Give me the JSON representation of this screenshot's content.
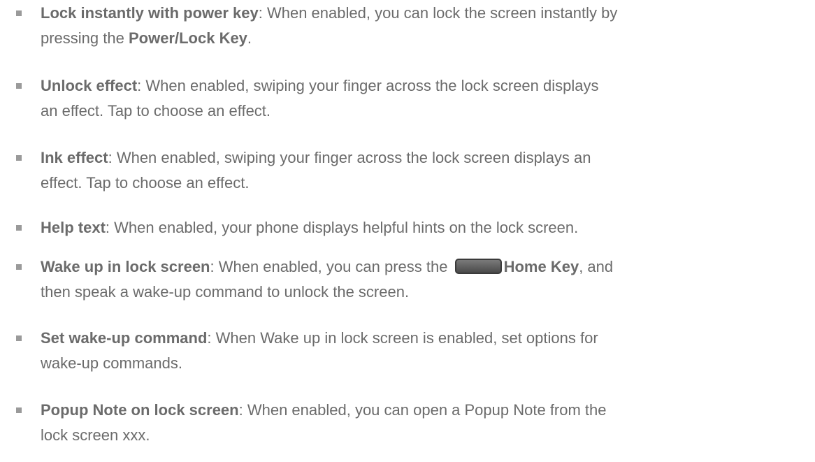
{
  "items": [
    {
      "term": "Lock instantly with power key",
      "line1": ": When enabled, you can lock the screen instantly by",
      "line2_pre": "pressing the ",
      "line2_bold": "Power/Lock Key",
      "line2_post": "."
    },
    {
      "term": "Unlock effect",
      "line1": ": When enabled, swiping your finger across the lock screen displays",
      "line2": "an effect. Tap to choose an effect."
    },
    {
      "term": "Ink effect",
      "line1": ": When enabled, swiping your finger across the lock screen displays an",
      "line2": "effect. Tap to choose an effect."
    },
    {
      "term": "Help text",
      "line1": ": When enabled, your phone displays helpful hints on the lock screen."
    },
    {
      "term": "Wake up in lock screen",
      "line1_pre": ": When enabled, you can press the ",
      "icon": "home-key-icon",
      "line1_bold": "Home Key",
      "line1_post": ", and",
      "line2": "then speak a wake-up command to unlock the screen."
    },
    {
      "term": "Set wake-up command",
      "line1": ": When Wake up in lock screen is enabled, set options for",
      "line2": "wake-up commands."
    },
    {
      "term": "Popup Note on lock screen",
      "line1": ": When enabled, you can open a Popup Note from the",
      "line2": "lock screen xxx."
    }
  ]
}
